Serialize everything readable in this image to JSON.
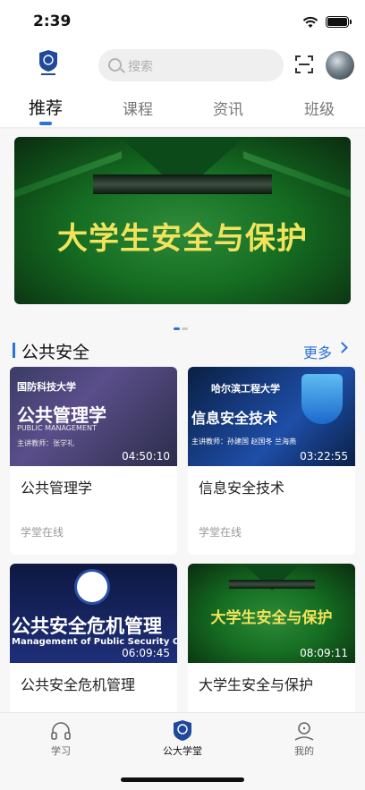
{
  "status": {
    "time": "2:39"
  },
  "header": {
    "search_placeholder": "搜索",
    "logo_label": "公大学堂"
  },
  "tabs": [
    "推荐",
    "课程",
    "资讯",
    "班级"
  ],
  "banner": {
    "title": "大学生安全与保护"
  },
  "section": {
    "title": "公共安全",
    "more": "更多"
  },
  "courses": [
    {
      "title": "公共管理学",
      "source": "学堂在线",
      "duration": "04:50:10",
      "thumb": {
        "school": "国防科技大学",
        "big": "公共管理学",
        "sub": "PUBLIC MANAGEMENT",
        "teacher": "主讲教师：张学礼"
      }
    },
    {
      "title": "信息安全技术",
      "source": "学堂在线",
      "duration": "03:22:55",
      "thumb": {
        "school": "哈尔滨工程大学",
        "big": "信息安全技术",
        "teacher": "主讲教师：孙建国 赵国冬 兰海燕"
      }
    },
    {
      "title": "公共安全危机管理",
      "source": "",
      "duration": "06:09:45",
      "thumb": {
        "big": "公共安全危机管理",
        "sub": "Management of Public Security Crisis"
      }
    },
    {
      "title": "大学生安全与保护",
      "source": "",
      "duration": "08:09:11",
      "thumb": {
        "big": "大学生安全与保护"
      }
    }
  ],
  "tabbar": [
    {
      "label": "学习",
      "icon": "headphones-icon"
    },
    {
      "label": "公大学堂",
      "icon": "school-logo-icon"
    },
    {
      "label": "我的",
      "icon": "person-icon"
    }
  ],
  "colors": {
    "accent": "#2b73d9",
    "banner_text": "#f3e35c"
  }
}
